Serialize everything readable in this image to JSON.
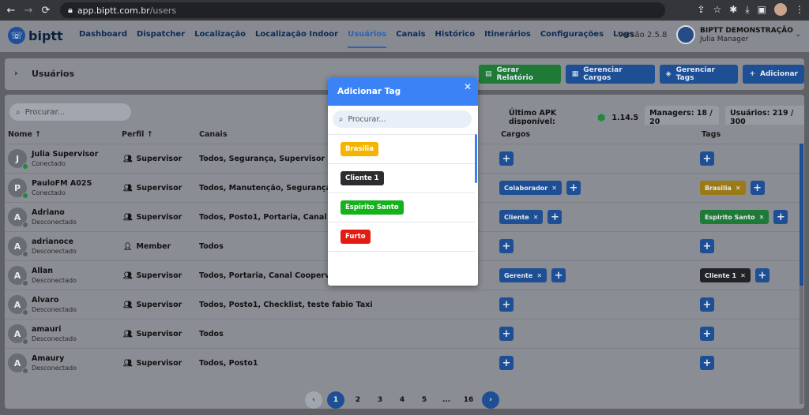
{
  "browser": {
    "url_host": "app.biptt.com.br",
    "url_path": "/users"
  },
  "app": {
    "logo": "biptt",
    "menu": [
      "Dashboard",
      "Dispatcher",
      "Localização",
      "Localização Indoor",
      "Usuários",
      "Canais",
      "Histórico",
      "Itinerários",
      "Configurações",
      "Logs"
    ],
    "active_menu": "Usuários",
    "version": "Versão 2.5.8",
    "account": {
      "org": "BIPTT DEMONSTRAÇÃO",
      "user": "Julia Manager"
    }
  },
  "page": {
    "title": "Usuários",
    "buttons": {
      "report": "Gerar Relatório",
      "roles": "Gerenciar Cargos",
      "tags": "Gerenciar Tags",
      "add": "Adicionar"
    },
    "search_placeholder": "Procurar...",
    "apk_label": "Último APK disponível:",
    "apk_version": "1.14.5",
    "managers": "Managers: 18 / 20",
    "users": "Usuários: 219 / 300"
  },
  "table": {
    "headers": {
      "name": "Nome",
      "profile": "Perfil",
      "channels": "Canais",
      "roles": "Cargos",
      "tags": "Tags"
    },
    "rows": [
      {
        "initial": "J",
        "name": "Julia Supervisor",
        "status": "Conectado",
        "online": true,
        "profile": "Supervisor",
        "channels": "Todos, Segurança, Supervisor",
        "cargos": [],
        "tags": []
      },
      {
        "initial": "P",
        "name": "PauloFM A02S",
        "status": "Conectado",
        "online": true,
        "profile": "Supervisor",
        "channels": "Todos, Manutenção, Segurança, Es",
        "cargos": [
          {
            "label": "Colaborador"
          }
        ],
        "tags": [
          {
            "label": "Brasilia",
            "color": "#9a7a18"
          }
        ]
      },
      {
        "initial": "A",
        "name": "Adriano",
        "status": "Desconectado",
        "online": false,
        "profile": "Supervisor",
        "channels": "Todos, Posto1, Portaria, Canal Coop",
        "cargos": [
          {
            "label": "Cliente"
          }
        ],
        "tags": [
          {
            "label": "Espirito Santo",
            "color": "#1e7a36"
          }
        ]
      },
      {
        "initial": "A",
        "name": "adrianoce",
        "status": "Desconectado",
        "online": false,
        "profile": "Member",
        "channels": "Todos",
        "cargos": [],
        "tags": []
      },
      {
        "initial": "A",
        "name": "Allan",
        "status": "Desconectado",
        "online": false,
        "profile": "Supervisor",
        "channels": "Todos, Portaria, Canal Coopervap",
        "cargos": [
          {
            "label": "Gerente"
          }
        ],
        "tags": [
          {
            "label": "Cliente 1",
            "color": "#222326"
          }
        ]
      },
      {
        "initial": "A",
        "name": "Alvaro",
        "status": "Desconectado",
        "online": false,
        "profile": "Supervisor",
        "channels": "Todos, Posto1, Checklist, teste fabio Taxi",
        "cargos": [],
        "tags": []
      },
      {
        "initial": "A",
        "name": "amauri",
        "status": "Desconectado",
        "online": false,
        "profile": "Supervisor",
        "channels": "Todos",
        "cargos": [],
        "tags": []
      },
      {
        "initial": "A",
        "name": "Amaury",
        "status": "Desconectado",
        "online": false,
        "profile": "Supervisor",
        "channels": "Todos, Posto1",
        "cargos": [],
        "tags": []
      }
    ]
  },
  "pagination": {
    "pages": [
      "1",
      "2",
      "3",
      "4",
      "5",
      "...",
      "16"
    ],
    "current": "1"
  },
  "modal": {
    "title": "Adicionar Tag",
    "search_placeholder": "Procurar...",
    "tags": [
      {
        "label": "Brasilia",
        "color": "#f4b400"
      },
      {
        "label": "Cliente 1",
        "color": "#2b2d31"
      },
      {
        "label": "Espirito Santo",
        "color": "#16b21c"
      },
      {
        "label": "Furto",
        "color": "#e31b12"
      }
    ]
  },
  "colors": {
    "primary": "#1e4f94",
    "modal_header": "#3b82f6",
    "online": "#1f8a3c"
  }
}
